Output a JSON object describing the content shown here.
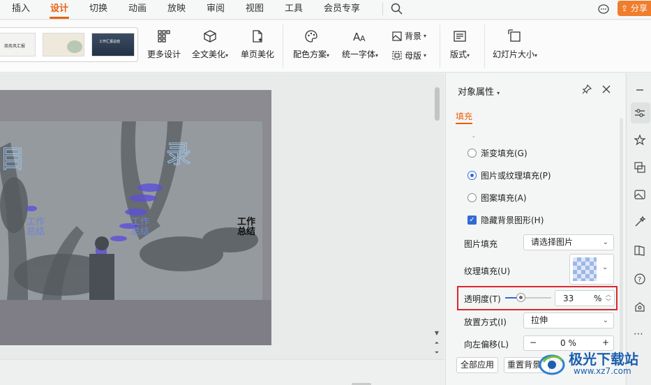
{
  "menu": {
    "items": [
      "插入",
      "设计",
      "切换",
      "动画",
      "放映",
      "审阅",
      "视图",
      "工具",
      "会员专享"
    ],
    "active": "设计",
    "share_label": "分享"
  },
  "ribbon": {
    "more_design": "更多设计",
    "full_beautify": "全文美化",
    "page_beautify": "单页美化",
    "color_scheme": "配色方案",
    "unify_font": "统一字体",
    "background": "背景",
    "master": "母版",
    "layout": "版式",
    "slide_size": "幻灯片大小",
    "thumbnails": [
      "商务风汇报",
      "",
      "工作汇报总结"
    ]
  },
  "slide": {
    "title_left": "目",
    "title_right": "录",
    "items": [
      "工作\n总结",
      "工作\n总结",
      "工作\n总结"
    ]
  },
  "panel": {
    "title": "对象属性",
    "tab": "填充",
    "fill_options": [
      {
        "label": "渐变填充(G)",
        "selected": false
      },
      {
        "label": "图片或纹理填充(P)",
        "selected": true
      },
      {
        "label": "图案填充(A)",
        "selected": false
      }
    ],
    "hide_bg_label": "隐藏背景图形(H)",
    "hide_bg_checked": true,
    "picture_fill_label": "图片填充",
    "picture_fill_value": "请选择图片",
    "texture_fill_label": "纹理填充(U)",
    "transparency_label": "透明度(T)",
    "transparency_value": "33",
    "transparency_unit": "%",
    "transparency_level": 0.33,
    "placement_label": "放置方式(I)",
    "placement_value": "拉伸",
    "offset_left_label": "向左偏移(L)",
    "offset_left_value": "0 %",
    "apply_all": "全部应用",
    "reset_bg": "重置背景"
  },
  "watermark": {
    "text": "极光下载站",
    "url": "www.xz7.com"
  },
  "colors": {
    "accent": "#e8600d",
    "share": "#f07d2c",
    "selection": "#2f6bd3",
    "highlight_box": "#d9272e"
  }
}
